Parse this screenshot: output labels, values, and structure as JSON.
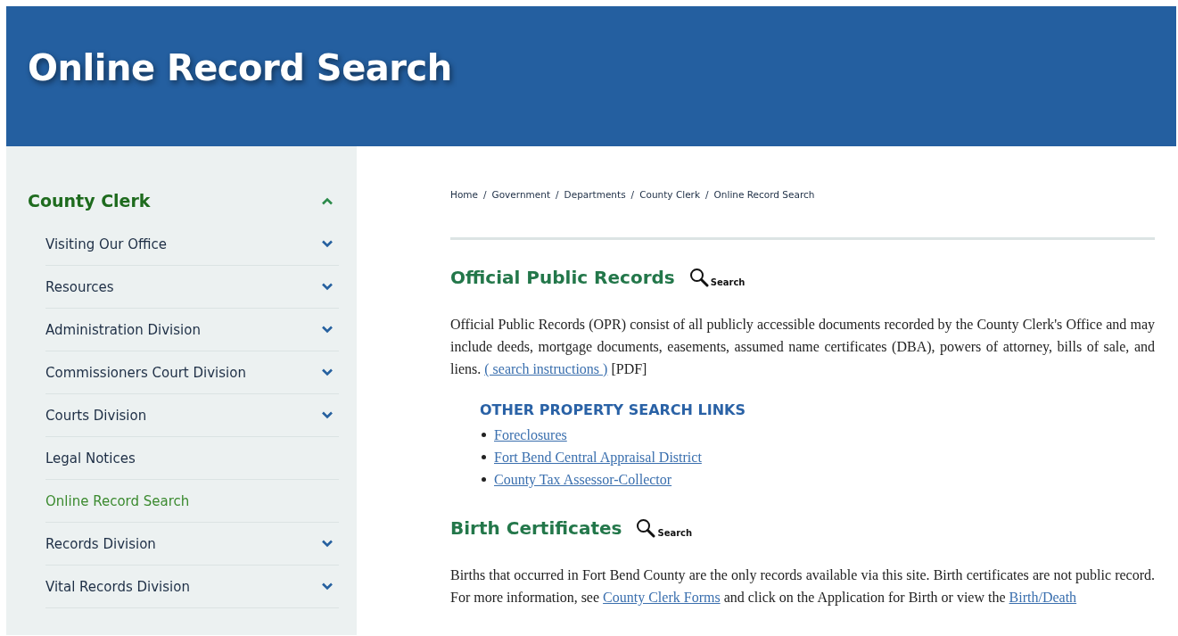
{
  "banner": {
    "title": "Online Record Search"
  },
  "sidebar": {
    "heading": "County Clerk",
    "expanded": true,
    "items": [
      {
        "label": "Visiting Our Office",
        "expandable": true,
        "selected": false
      },
      {
        "label": "Resources",
        "expandable": true,
        "selected": false
      },
      {
        "label": "Administration Division",
        "expandable": true,
        "selected": false
      },
      {
        "label": "Commissioners Court Division",
        "expandable": true,
        "selected": false
      },
      {
        "label": "Courts Division",
        "expandable": true,
        "selected": false
      },
      {
        "label": "Legal Notices",
        "expandable": false,
        "selected": false
      },
      {
        "label": "Online Record Search",
        "expandable": false,
        "selected": true
      },
      {
        "label": "Records Division",
        "expandable": true,
        "selected": false
      },
      {
        "label": "Vital Records Division",
        "expandable": true,
        "selected": false
      }
    ]
  },
  "breadcrumb": [
    "Home",
    "Government",
    "Departments",
    "County Clerk",
    "Online Record Search"
  ],
  "breadcrumb_separator": "/",
  "sections": [
    {
      "heading": "Official Public Records",
      "search_label": "Search",
      "paragraph": [
        {
          "text": "Official Public Records (OPR) consist of all publicly accessible documents recorded by the County Clerk's Office and may include deeds, mortgage documents, easements, assumed name certificates (DBA), powers of attorney, bills of sale, and liens. "
        },
        {
          "link": "( search instructions )"
        },
        {
          "text": " [PDF]"
        }
      ],
      "subheading": "OTHER PROPERTY SEARCH LINKS",
      "links": [
        "Foreclosures",
        "Fort Bend Central Appraisal District",
        "County Tax Assessor-Collector"
      ]
    },
    {
      "heading": "Birth Certificates",
      "search_label": "Search",
      "paragraph": [
        {
          "text": "Births that occurred in Fort Bend County are the only records available via this site. Birth certificates are not public record. For more information, see "
        },
        {
          "link": "County Clerk Forms"
        },
        {
          "text": " and click on the Application for Birth or view the "
        },
        {
          "link": "Birth/Death"
        }
      ]
    }
  ]
}
